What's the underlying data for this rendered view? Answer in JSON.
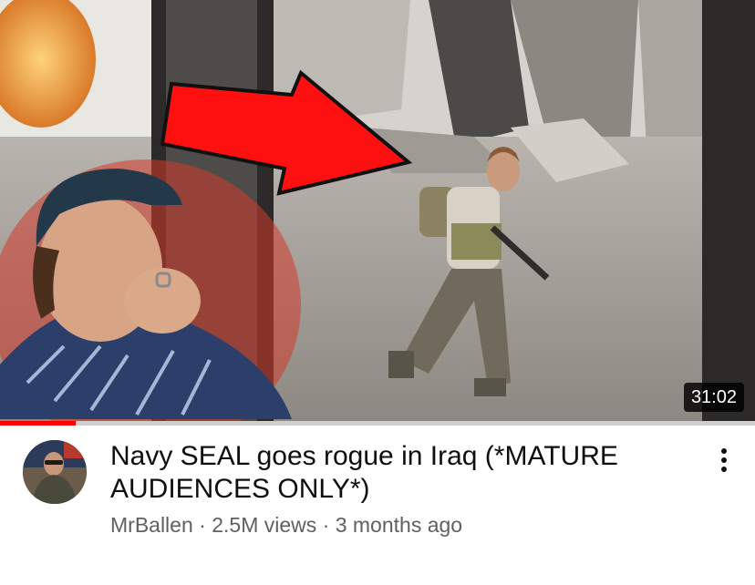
{
  "video": {
    "duration": "31:02",
    "progress_fraction": 0.1,
    "title": "Navy SEAL goes rogue in Iraq (*MATURE AUDIENCES ONLY*)",
    "channel": "MrBallen",
    "views": "2.5M views",
    "age": "3 months ago",
    "separator": " · "
  },
  "icons": {
    "more": "more-vert-icon",
    "avatar": "channel-avatar"
  },
  "colors": {
    "progress": "#ff0000",
    "title": "#0f0f0f",
    "meta": "#606060"
  }
}
